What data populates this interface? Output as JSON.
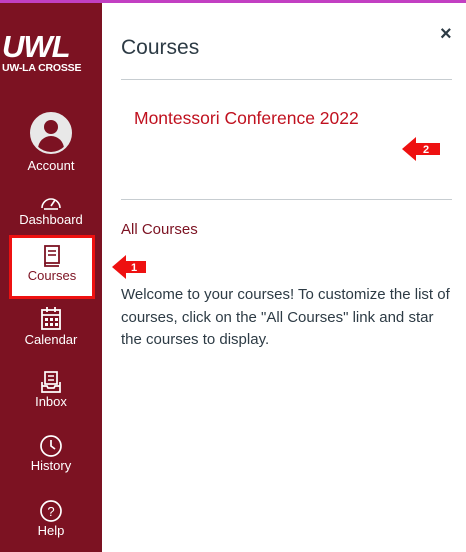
{
  "brand": {
    "logo_text": "UWL",
    "logo_subtitle": "UW-LA CROSSE",
    "sidebar_color": "#7c1222",
    "accent_color": "#c0111f"
  },
  "nav": {
    "account": {
      "label": "Account",
      "icon": "user-avatar-icon"
    },
    "dashboard": {
      "label": "Dashboard",
      "icon": "speedometer-icon"
    },
    "courses": {
      "label": "Courses",
      "icon": "book-icon",
      "active": true
    },
    "calendar": {
      "label": "Calendar",
      "icon": "calendar-icon"
    },
    "inbox": {
      "label": "Inbox",
      "icon": "inbox-icon"
    },
    "history": {
      "label": "History",
      "icon": "clock-icon"
    },
    "help": {
      "label": "Help",
      "icon": "help-circle-icon"
    }
  },
  "tray": {
    "title": "Courses",
    "close_glyph": "×",
    "course_name": "Montessori Conference 2022",
    "all_courses_label": "All Courses",
    "welcome_text": "Welcome to your courses! To customize the list of courses, click on the \"All Courses\" link and star the courses to display."
  },
  "annotations": {
    "step1": "1",
    "step2": "2"
  }
}
